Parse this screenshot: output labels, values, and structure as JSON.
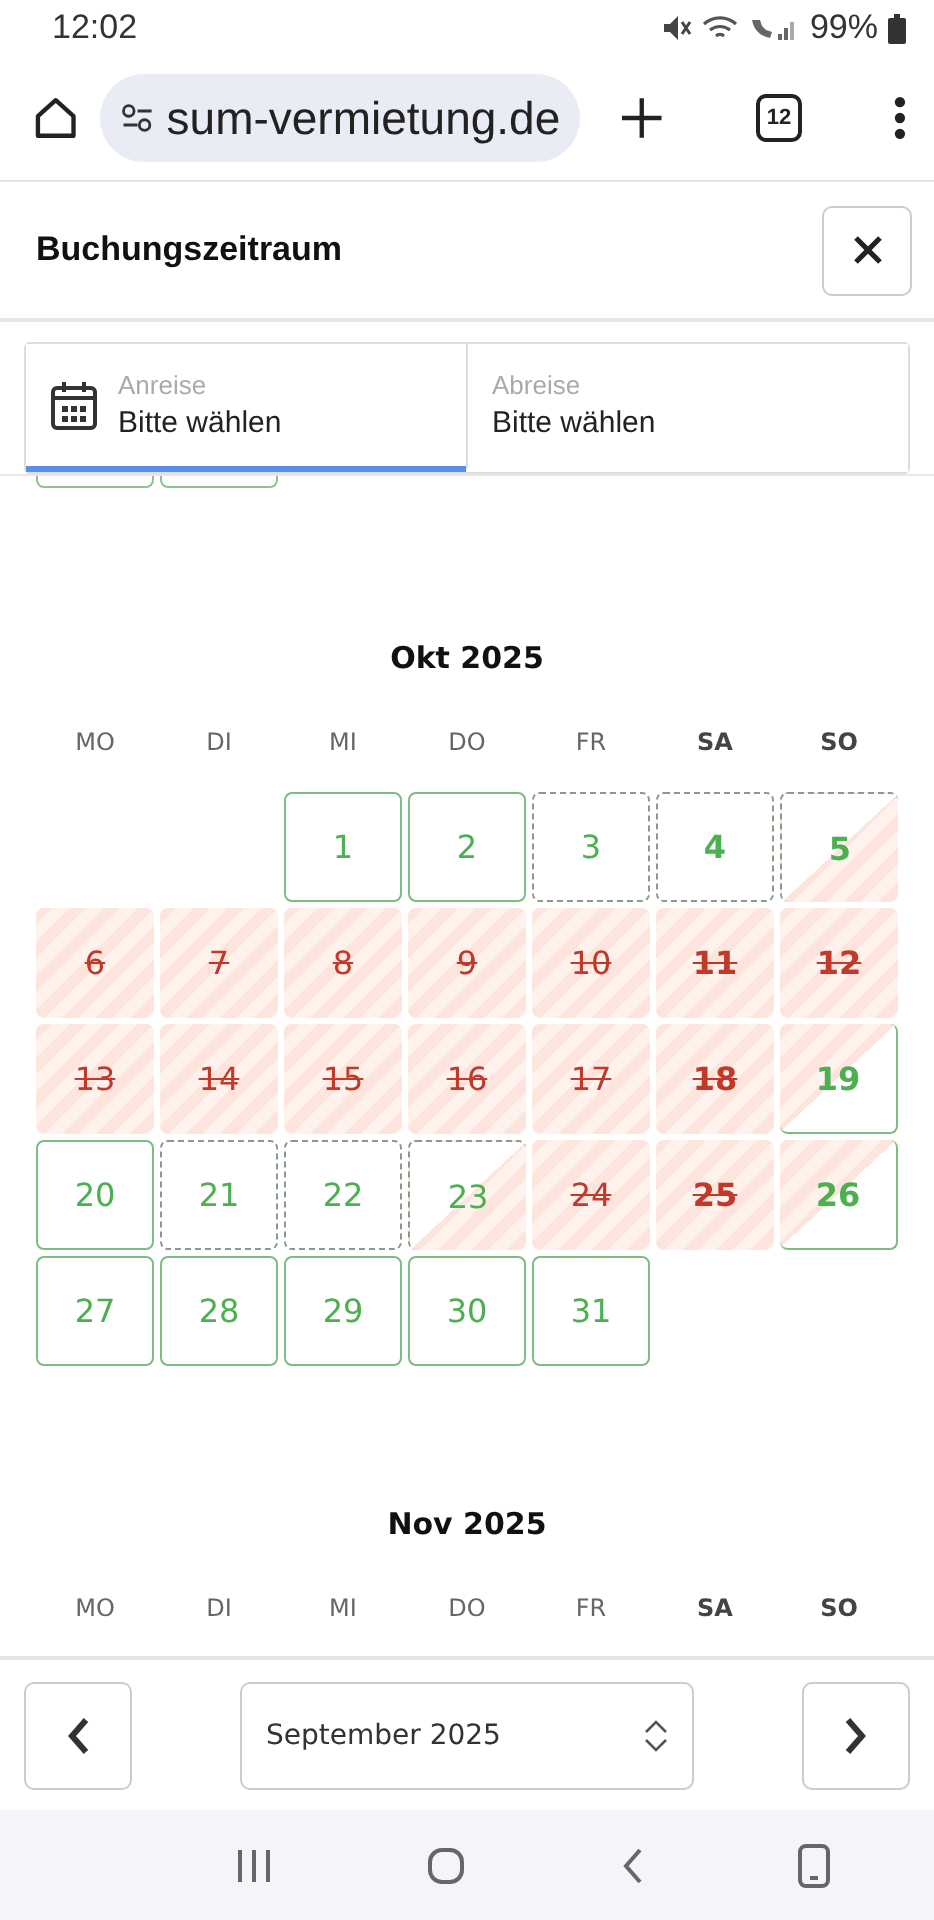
{
  "status_bar": {
    "time": "12:02",
    "battery": "99%"
  },
  "browser": {
    "url": "sum-vermietung.de",
    "tab_count": "12"
  },
  "dialog": {
    "title": "Buchungszeitraum"
  },
  "tabs": [
    {
      "label": "Anreise",
      "value": "Bitte wählen",
      "selected": true
    },
    {
      "label": "Abreise",
      "value": "Bitte wählen",
      "selected": false
    }
  ],
  "months": [
    {
      "title": "Okt 2025",
      "weekdays": [
        {
          "label": "MO",
          "weekend": false
        },
        {
          "label": "DI",
          "weekend": false
        },
        {
          "label": "MI",
          "weekend": false
        },
        {
          "label": "DO",
          "weekend": false
        },
        {
          "label": "FR",
          "weekend": false
        },
        {
          "label": "SA",
          "weekend": true
        },
        {
          "label": "SO",
          "weekend": true
        }
      ],
      "days": [
        {
          "kind": "empty"
        },
        {
          "kind": "empty"
        },
        {
          "day": "1",
          "kind": "free",
          "weekend": false
        },
        {
          "day": "2",
          "kind": "free",
          "weekend": false
        },
        {
          "day": "3",
          "kind": "limited",
          "weekend": false
        },
        {
          "day": "4",
          "kind": "limited",
          "weekend": true
        },
        {
          "day": "5",
          "kind": "limited_then_booked",
          "weekend": true
        },
        {
          "day": "6",
          "kind": "booked",
          "weekend": false
        },
        {
          "day": "7",
          "kind": "booked",
          "weekend": false
        },
        {
          "day": "8",
          "kind": "booked",
          "weekend": false
        },
        {
          "day": "9",
          "kind": "booked",
          "weekend": false
        },
        {
          "day": "10",
          "kind": "booked",
          "weekend": false
        },
        {
          "day": "11",
          "kind": "booked",
          "weekend": true
        },
        {
          "day": "12",
          "kind": "booked",
          "weekend": true
        },
        {
          "day": "13",
          "kind": "booked",
          "weekend": false
        },
        {
          "day": "14",
          "kind": "booked",
          "weekend": false
        },
        {
          "day": "15",
          "kind": "booked",
          "weekend": false
        },
        {
          "day": "16",
          "kind": "booked",
          "weekend": false
        },
        {
          "day": "17",
          "kind": "booked",
          "weekend": false
        },
        {
          "day": "18",
          "kind": "booked",
          "weekend": true
        },
        {
          "day": "19",
          "kind": "booked_then_free",
          "weekend": true
        },
        {
          "day": "20",
          "kind": "free",
          "weekend": false
        },
        {
          "day": "21",
          "kind": "limited",
          "weekend": false
        },
        {
          "day": "22",
          "kind": "limited",
          "weekend": false
        },
        {
          "day": "23",
          "kind": "limited_then_booked",
          "weekend": false
        },
        {
          "day": "24",
          "kind": "booked",
          "weekend": false
        },
        {
          "day": "25",
          "kind": "booked",
          "weekend": true
        },
        {
          "day": "26",
          "kind": "booked_then_free",
          "weekend": true
        },
        {
          "day": "27",
          "kind": "free",
          "weekend": false
        },
        {
          "day": "28",
          "kind": "free",
          "weekend": false
        },
        {
          "day": "29",
          "kind": "free",
          "weekend": false
        },
        {
          "day": "30",
          "kind": "free",
          "weekend": false
        },
        {
          "day": "31",
          "kind": "free",
          "weekend": false
        }
      ]
    },
    {
      "title": "Nov 2025",
      "weekdays": [
        {
          "label": "MO",
          "weekend": false
        },
        {
          "label": "DI",
          "weekend": false
        },
        {
          "label": "MI",
          "weekend": false
        },
        {
          "label": "DO",
          "weekend": false
        },
        {
          "label": "FR",
          "weekend": false
        },
        {
          "label": "SA",
          "weekend": true
        },
        {
          "label": "SO",
          "weekend": true
        }
      ]
    }
  ],
  "navigation": {
    "month_select": "September 2025"
  }
}
